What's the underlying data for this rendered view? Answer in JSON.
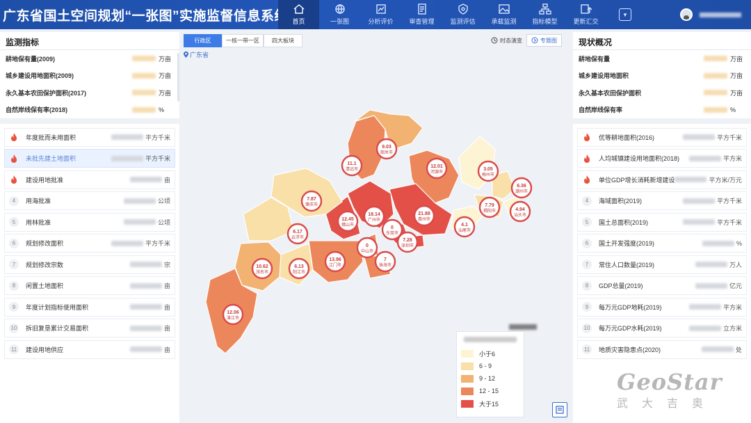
{
  "app": {
    "title": "广东省国土空间规划“一张图”实施监督信息系统"
  },
  "nav": {
    "items": [
      {
        "label": "首页",
        "icon": "home-icon",
        "active": true
      },
      {
        "label": "一张图",
        "icon": "globe-icon"
      },
      {
        "label": "分析评价",
        "icon": "chart-icon"
      },
      {
        "label": "审查管理",
        "icon": "document-icon"
      },
      {
        "label": "监测评估",
        "icon": "shield-icon"
      },
      {
        "label": "承载监测",
        "icon": "image-icon"
      },
      {
        "label": "指标模型",
        "icon": "model-icon"
      },
      {
        "label": "更新汇交",
        "icon": "upload-icon"
      }
    ]
  },
  "user": {
    "name": ""
  },
  "left_panel": {
    "title": "监测指标",
    "kpis": [
      {
        "label": "耕地保有量(2009)",
        "unit": "万亩"
      },
      {
        "label": "城乡建设用地面积(2009)",
        "unit": "万亩"
      },
      {
        "label": "永久基本农田保护面积(2017)",
        "unit": "万亩"
      },
      {
        "label": "自然岸线保有率(2018)",
        "unit": "%"
      }
    ],
    "rows": [
      {
        "num": "",
        "fire": true,
        "label": "年度批而未用面积",
        "unit": "平方千米"
      },
      {
        "num": "",
        "fire": true,
        "label": "未批先建土地面积",
        "unit": "平方千米",
        "highlight": true
      },
      {
        "num": "",
        "fire": true,
        "label": "建设用地批准",
        "unit": "亩"
      },
      {
        "num": "4",
        "label": "用海批准",
        "unit": "公顷"
      },
      {
        "num": "5",
        "label": "用林批准",
        "unit": "公顷"
      },
      {
        "num": "6",
        "label": "规划修改面积",
        "unit": "平方千米"
      },
      {
        "num": "7",
        "label": "规划修改宗数",
        "unit": "宗"
      },
      {
        "num": "8",
        "label": "闲置土地面积",
        "unit": "亩"
      },
      {
        "num": "9",
        "label": "年度计划指标使用面积",
        "unit": "亩"
      },
      {
        "num": "10",
        "label": "拆旧复垦累计交易面积",
        "unit": "亩"
      },
      {
        "num": "11",
        "label": "建设用地供应",
        "unit": "亩"
      }
    ]
  },
  "right_panel": {
    "title": "现状概况",
    "kpis": [
      {
        "label": "耕地保有量",
        "unit": "万亩"
      },
      {
        "label": "城乡建设用地面积",
        "unit": "万亩"
      },
      {
        "label": "永久基本农田保护面积",
        "unit": "万亩"
      },
      {
        "label": "自然岸线保有率",
        "unit": "%"
      }
    ],
    "rows": [
      {
        "num": "",
        "fire": true,
        "label": "优等耕地面积(2016)",
        "unit": "平方千米"
      },
      {
        "num": "",
        "fire": true,
        "label": "人均城镇建设用地面积(2018)",
        "unit": "平方米"
      },
      {
        "num": "",
        "fire": true,
        "label": "单位GDP增长消耗新增建设...",
        "unit": "平方米/万元"
      },
      {
        "num": "4",
        "label": "海域面积(2019)",
        "unit": "平方千米"
      },
      {
        "num": "5",
        "label": "国土总面积(2019)",
        "unit": "平方千米"
      },
      {
        "num": "6",
        "label": "国土开发强度(2019)",
        "unit": "%"
      },
      {
        "num": "7",
        "label": "常住人口数量(2019)",
        "unit": "万人"
      },
      {
        "num": "8",
        "label": "GDP总量(2019)",
        "unit": "亿元"
      },
      {
        "num": "9",
        "label": "每万元GDP地耗(2019)",
        "unit": "平方米"
      },
      {
        "num": "10",
        "label": "每万元GDP水耗(2019)",
        "unit": "立方米"
      },
      {
        "num": "11",
        "label": "地质灾害隐患点(2020)",
        "unit": "处"
      }
    ]
  },
  "map": {
    "tabs": [
      {
        "label": "行政区",
        "active": true
      },
      {
        "label": "一核一带一区"
      },
      {
        "label": "四大板块"
      }
    ],
    "region": "广东省",
    "tools": {
      "timeline_label": "时态演变",
      "thematic_label": "专题图"
    },
    "cities": [
      {
        "value": "11.1",
        "name": "清远市",
        "level": 3
      },
      {
        "value": "9.03",
        "name": "韶关市",
        "level": 2
      },
      {
        "value": "12.01",
        "name": "河源市",
        "level": 3
      },
      {
        "value": "3.05",
        "name": "梅州市",
        "level": 0
      },
      {
        "value": "6.36",
        "name": "潮州市",
        "level": 1
      },
      {
        "value": "4.94",
        "name": "汕头市",
        "level": 0
      },
      {
        "value": "7.79",
        "name": "揭阳市",
        "level": 1
      },
      {
        "value": "4.1",
        "name": "汕尾市",
        "level": 0
      },
      {
        "value": "21.88",
        "name": "惠州市",
        "level": 4
      },
      {
        "value": "18.14",
        "name": "广州市",
        "level": 4
      },
      {
        "value": "0",
        "name": "东莞市",
        "level": 4
      },
      {
        "value": "7.28",
        "name": "深圳市",
        "level": 4
      },
      {
        "value": "12.45",
        "name": "佛山市",
        "level": 4
      },
      {
        "value": "7.87",
        "name": "肇庆市",
        "level": 1
      },
      {
        "value": "6.17",
        "name": "云浮市",
        "level": 1
      },
      {
        "value": "0",
        "name": "中山市",
        "level": 3
      },
      {
        "value": "7",
        "name": "珠海市",
        "level": 3
      },
      {
        "value": "13.96",
        "name": "江门市",
        "level": 3
      },
      {
        "value": "6.13",
        "name": "阳江市",
        "level": 1
      },
      {
        "value": "10.62",
        "name": "茂名市",
        "level": 2
      },
      {
        "value": "12.06",
        "name": "湛江市",
        "level": 3
      }
    ],
    "legend": {
      "items": [
        {
          "label": "小于6",
          "color": "#fdf4d4"
        },
        {
          "label": "6 - 9",
          "color": "#f9dfa8"
        },
        {
          "label": "9 - 12",
          "color": "#f2b272"
        },
        {
          "label": "12 - 15",
          "color": "#ec875b"
        },
        {
          "label": "大于15",
          "color": "#e25048"
        }
      ]
    }
  },
  "watermark": {
    "brand": "GeoStar",
    "sub": "武大吉奥"
  }
}
